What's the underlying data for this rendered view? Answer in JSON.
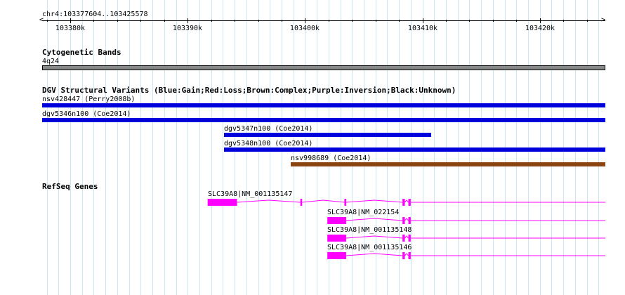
{
  "location": "chr4:103377604..103425578",
  "ruler": {
    "start": 103377604,
    "end": 103425578,
    "ticks": [
      {
        "pos": 103380000,
        "label": "103380k"
      },
      {
        "pos": 103390000,
        "label": "103390k"
      },
      {
        "pos": 103400000,
        "label": "103400k"
      },
      {
        "pos": 103410000,
        "label": "103410k"
      },
      {
        "pos": 103420000,
        "label": "103420k"
      }
    ]
  },
  "cytoband": {
    "title": "Cytogenetic Bands",
    "band": "4q24",
    "color": "#888888"
  },
  "dgv": {
    "title": "DGV Structural Variants (Blue:Gain;Red:Loss;Brown:Complex;Purple:Inversion;Black:Unknown)",
    "variants": [
      {
        "label": "nsv428447 (Perry2008b)",
        "start": 103377604,
        "end": 103425578,
        "color": "#0000dd"
      },
      {
        "label": "dgv5346n100 (Coe2014)",
        "start": 103377604,
        "end": 103425578,
        "color": "#0000dd"
      },
      {
        "label": "dgv5347n100 (Coe2014)",
        "start": 103393100,
        "end": 103410750,
        "color": "#0000dd"
      },
      {
        "label": "dgv5348n100 (Coe2014)",
        "start": 103393100,
        "end": 103425578,
        "color": "#0000dd"
      },
      {
        "label": "nsv998689 (Coe2014)",
        "start": 103398800,
        "end": 103425578,
        "color": "#8b4513"
      }
    ]
  },
  "refseq": {
    "title": "RefSeq Genes",
    "color": "#ff00ff",
    "transcripts": [
      {
        "label": "SLC39A8|NM_001135147",
        "start": 103391700,
        "end": 103425578,
        "exons": [
          [
            103391700,
            103394200
          ],
          [
            103399600,
            103399750
          ],
          [
            103403350,
            103403500
          ],
          [
            103408300,
            103408500
          ],
          [
            103408800,
            103409000
          ]
        ]
      },
      {
        "label": "SLC39A8|NM_022154",
        "start": 103401900,
        "end": 103425578,
        "exons": [
          [
            103401900,
            103403500
          ],
          [
            103408300,
            103408500
          ],
          [
            103408800,
            103409000
          ]
        ]
      },
      {
        "label": "SLC39A8|NM_001135148",
        "start": 103401900,
        "end": 103425578,
        "exons": [
          [
            103401900,
            103403500
          ],
          [
            103408300,
            103408500
          ],
          [
            103408800,
            103409000
          ]
        ]
      },
      {
        "label": "SLC39A8|NM_001135146",
        "start": 103401900,
        "end": 103425578,
        "exons": [
          [
            103401900,
            103403500
          ],
          [
            103408300,
            103408500
          ],
          [
            103408800,
            103409000
          ]
        ]
      }
    ]
  }
}
